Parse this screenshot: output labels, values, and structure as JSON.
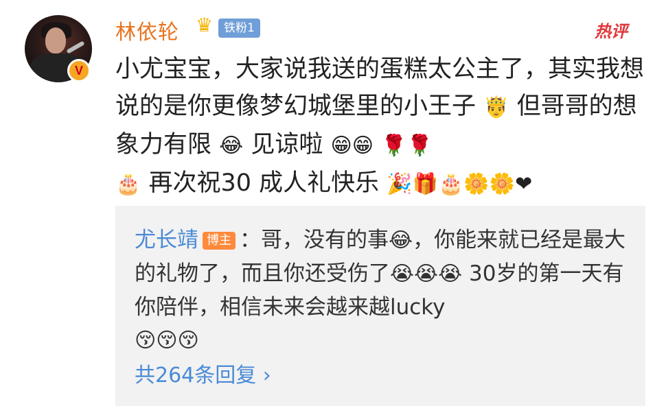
{
  "comment": {
    "username": "林依轮",
    "fan_badge": "铁粉1",
    "hot_label": "热评",
    "text": "小尤宝宝，大家说我送的蛋糕太公主了，其实我想说的是你更像梦幻城堡里的小王子",
    "text2": "但哥哥的想象力有限",
    "text3": "见谅啦",
    "text4": "再次祝30 成人礼快乐"
  },
  "reply": {
    "name": "尤长靖",
    "badge": "博主",
    "colon": "：",
    "text1": "哥，没有的事",
    "text2": "，你能来就已经是最大的礼物了，而且你还受伤了",
    "text3": " 30岁的第一天有你陪伴，相信未来会越来越lucky",
    "count": "共264条回复 ›"
  },
  "colors": {
    "username": "#e8731e",
    "link": "#4a8ad6",
    "hot": "#e0373a",
    "badge": "#6f9ed8",
    "blogger_badge": "#ff8a3c"
  }
}
